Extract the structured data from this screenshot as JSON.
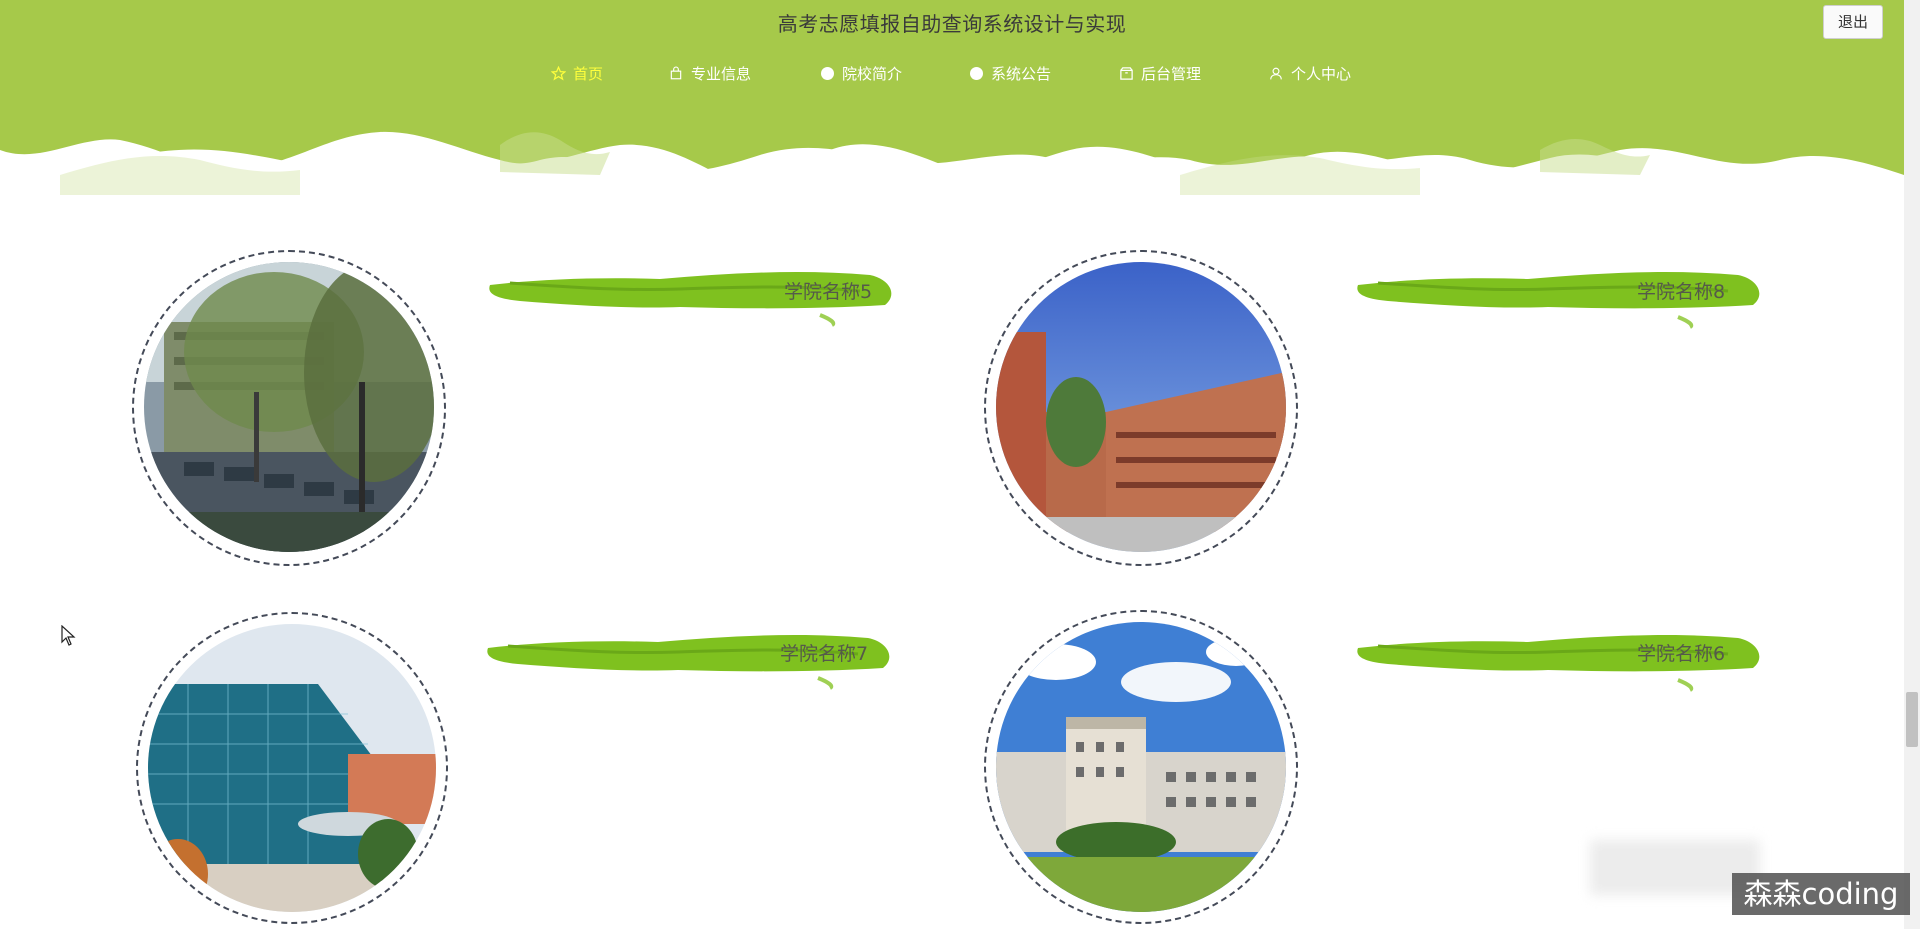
{
  "app": {
    "title": "高考志愿填报自助查询系统设计与实现",
    "logout_label": "退出",
    "accent": "#a6c94a",
    "active_nav_color": "#ffff3c"
  },
  "nav": {
    "items": [
      {
        "label": "首页",
        "icon": "star-icon",
        "active": true
      },
      {
        "label": "专业信息",
        "icon": "bag-icon",
        "active": false
      },
      {
        "label": "院校简介",
        "icon": "dot-icon",
        "active": false
      },
      {
        "label": "系统公告",
        "icon": "dot-icon",
        "active": false
      },
      {
        "label": "后台管理",
        "icon": "box-icon",
        "active": false
      },
      {
        "label": "个人中心",
        "icon": "user-icon",
        "active": false
      }
    ]
  },
  "colleges": [
    {
      "name": "学院名称5",
      "image": "campus-trees-photo"
    },
    {
      "name": "学院名称8",
      "image": "red-brick-building-photo"
    },
    {
      "name": "学院名称7",
      "image": "glass-building-photo"
    },
    {
      "name": "学院名称6",
      "image": "white-building-photo"
    }
  ],
  "watermark": "森森coding"
}
